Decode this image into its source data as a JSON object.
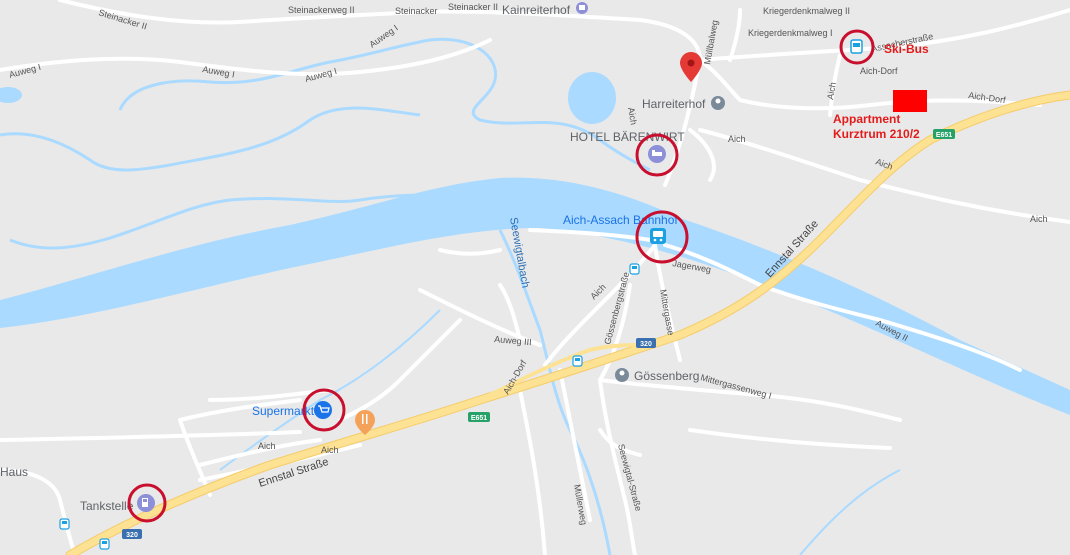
{
  "labels": {
    "kainreiterhof": "Kainreiterhof",
    "harreiterhof": "Harreiterhof",
    "hotel": "HOTEL BÄRENWIRT",
    "bahnhof": "Aich-Assach Bahnhof",
    "gossenberg": "Gössenberg",
    "supermarkt": "Supermarkt",
    "tankstelle": "Tankstelle",
    "haus": "Haus",
    "seewigtalbach": "Seewigtalbach",
    "ennstal_1": "Ennstal Straße",
    "ennstal_2": "Ennstal Straße",
    "steinacker": "Steinacker",
    "steinacker_ii": "Steinacker II",
    "steinacker_ii_2": "Steinackerweg II",
    "steinacker_ii_3": "Steinacker II",
    "auweg_1a": "Auweg I",
    "auweg_1b": "Auweg I",
    "auweg_1c": "Auweg I",
    "auweg_1d": "Auweg I",
    "auweg_iii": "Auweg III",
    "auweg_ii": "Auweg II",
    "kriegerdenkmalweg_ii": "Kriegerdenkmalweg II",
    "kriegerdenkmalweg_i": "Kriegerdenkmalweg I",
    "mullbalweg": "Müllbalweg",
    "assacherstrasse": "Assacherstraße",
    "aich_dorf_1": "Aich-Dorf",
    "aich_dorf_2": "Aich-Dorf",
    "aich_dorf_3": "Aich-Dorf",
    "aich_1": "Aich",
    "aich_2": "Aich",
    "aich_3": "Aich",
    "aich_4": "Aich",
    "aich_5": "Aich",
    "aich_6": "Aich",
    "aich_7": "Aich",
    "jagerweg": "Jagerweg",
    "mittergasse": "Mittergasse",
    "gossenbergstrasse": "Gössenbergstraße",
    "mittergassenweg": "Mittergassenweg I",
    "seewigtalstrasse": "Seewigtal-Straße",
    "mullerweg": "Müllerweg"
  },
  "annotations": {
    "ski_bus": "Ski-Bus",
    "appartment_line1": "Appartment",
    "appartment_line2": "Kurztrum 210/2"
  },
  "shields": {
    "e651_a": "E651",
    "e651_b": "E651",
    "r320_a": "320",
    "r320_b": "320"
  },
  "colors": {
    "land": "#e9e9e9",
    "water": "#aadaff",
    "main_road": "#fde293",
    "road": "#ffffff",
    "marker_circle": "#c8102e",
    "red_square": "#ff0000",
    "pin": "#e53935"
  },
  "icons": {
    "pin": "location-pin-icon",
    "hotel": "hotel-bed-icon",
    "train": "train-station-icon",
    "bus": "bus-stop-icon",
    "shop": "shopping-cart-icon",
    "restaurant": "restaurant-icon",
    "fuel": "fuel-station-icon",
    "landmark": "landmark-icon"
  }
}
